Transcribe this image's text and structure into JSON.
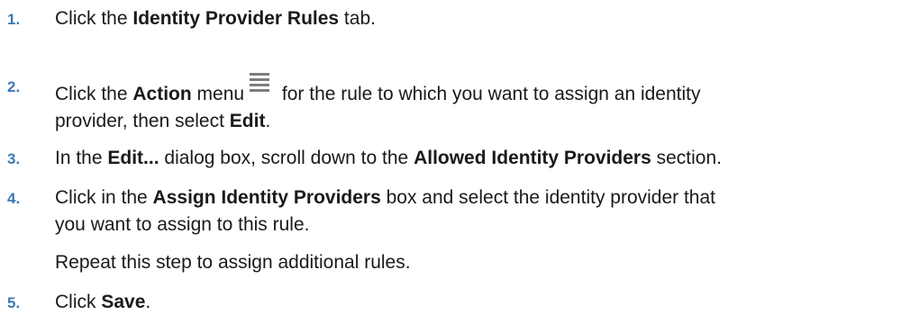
{
  "steps": [
    {
      "num": "1.",
      "parts": [
        "Click the ",
        "Identity Provider Rules",
        " tab."
      ]
    },
    {
      "num": "2.",
      "parts": [
        "Click the ",
        "Action",
        " menu",
        " for the rule to which you want to assign an identity",
        "provider, then select ",
        "Edit",
        "."
      ],
      "icon": "hamburger-menu-icon"
    },
    {
      "num": "3.",
      "parts": [
        "In the ",
        "Edit...",
        " dialog box, scroll down to the ",
        "Allowed Identity Providers",
        " section."
      ]
    },
    {
      "num": "4.",
      "parts": [
        "Click in the ",
        "Assign Identity Providers",
        " box and select the identity provider that",
        "you want to assign to this rule."
      ],
      "note": "Repeat this step to assign additional rules."
    },
    {
      "num": "5.",
      "parts": [
        "Click ",
        "Save",
        "."
      ]
    }
  ]
}
